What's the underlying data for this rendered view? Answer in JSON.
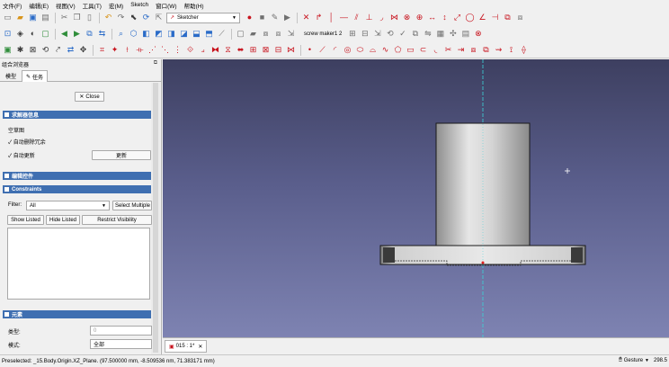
{
  "menu": [
    "文件(F)",
    "编辑(E)",
    "视图(V)",
    "工具(T)",
    "宏(M)",
    "Sketch",
    "窗口(W)",
    "帮助(H)"
  ],
  "toolbar": {
    "workbench": "Sketcher",
    "doc_name": "screw maker1 2"
  },
  "combo_view": {
    "title": "组合浏览器",
    "tabs": [
      "模型",
      "任务"
    ],
    "close_label": "Close",
    "solver": {
      "header": "求解器信息",
      "status": "空草图",
      "auto_remove_redundant": "自动删除冗余",
      "auto_update": "自动更新",
      "update_button": "更新"
    },
    "edit_controls": {
      "header": "编辑控件"
    },
    "constraints": {
      "header": "Constraints",
      "filter_label": "Filter:",
      "filter_value": "All",
      "select_multiple": "Select Multiple",
      "show_listed": "Show Listed",
      "hide_listed": "Hide Listed",
      "restrict_visibility": "Restrict Visibility"
    },
    "elements": {
      "header": "元素",
      "type_label": "类型:",
      "type_value": "0",
      "mode_label": "模式:",
      "mode_value": "全部"
    }
  },
  "view_tab": "015 : 1*",
  "status": {
    "preselected": "Preselected: _15.Body.Origin.XZ_Plane. (97.500000 mm, -8.509536 nm, 71.383171 mm)",
    "nav_style": "Gesture",
    "dims": "298.5"
  }
}
